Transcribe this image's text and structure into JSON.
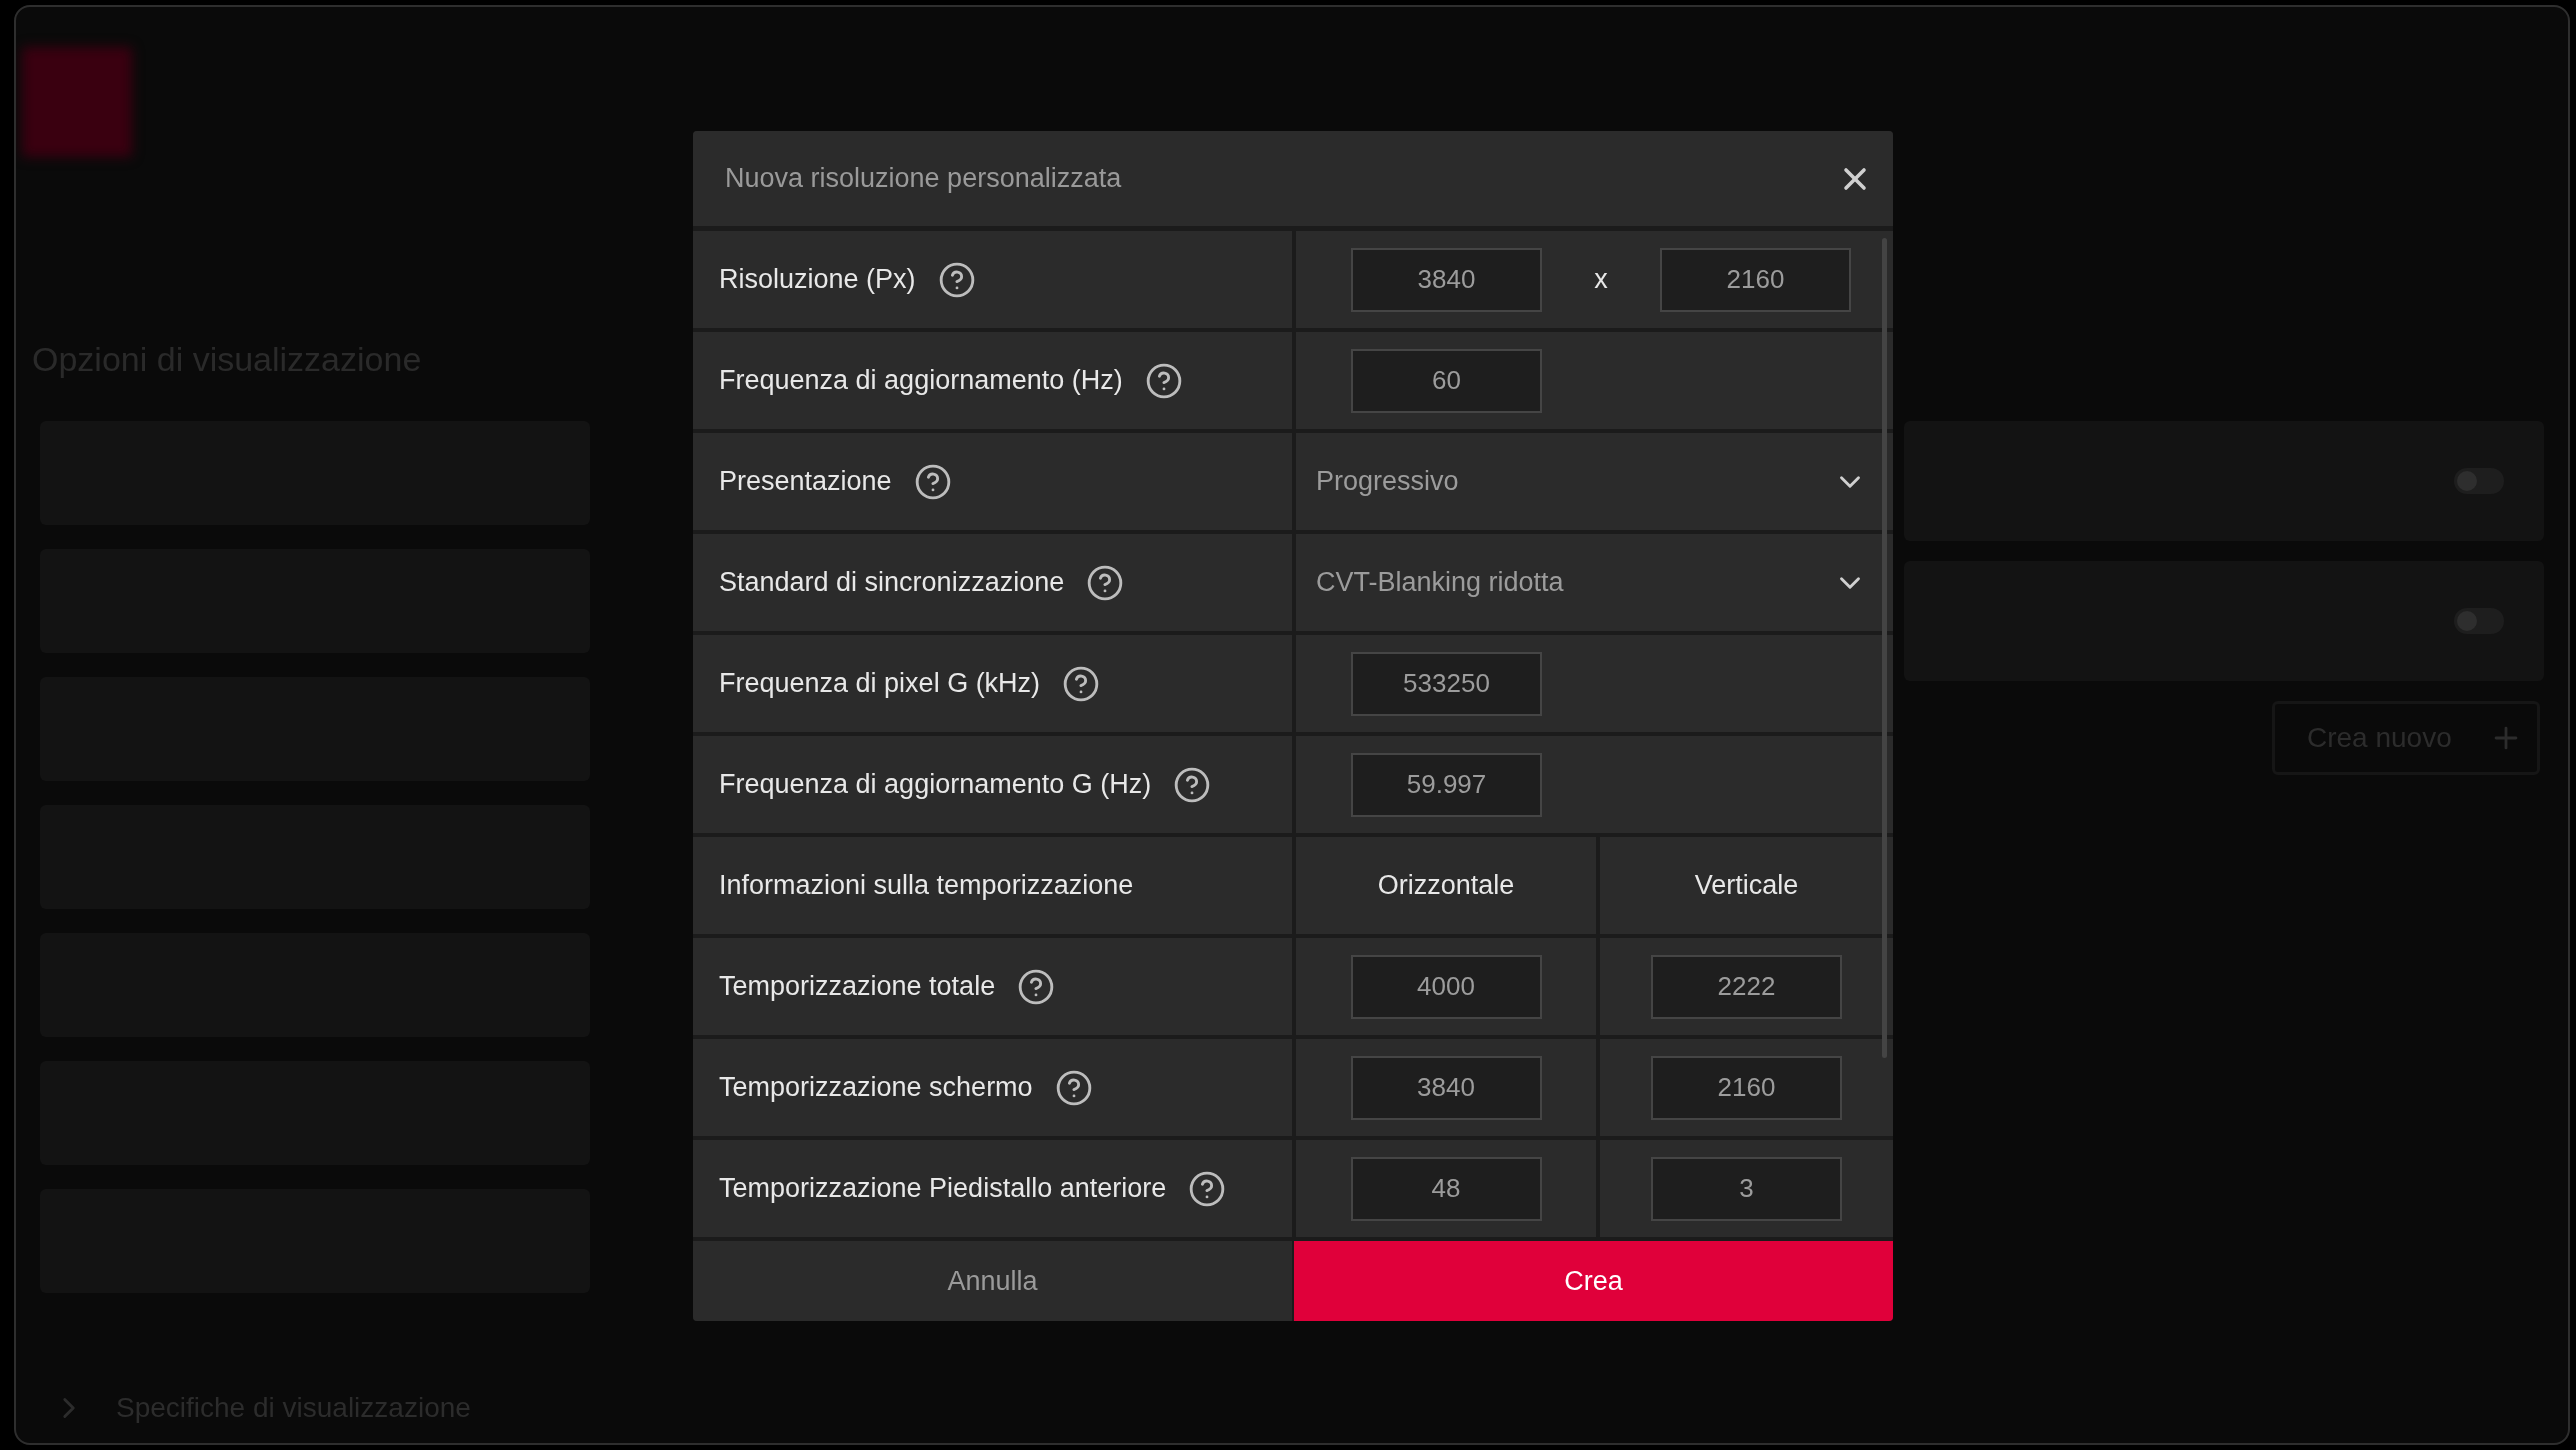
{
  "background": {
    "section_title": "Opzioni di visualizzazione",
    "toggles": [
      {
        "on": false
      },
      {
        "on": false
      }
    ],
    "create_button": {
      "label": "Crea nuovo"
    },
    "footer_link": {
      "label": "Specifiche di visualizzazione",
      "expanded": false
    }
  },
  "dialog": {
    "title": "Nuova risoluzione personalizzata",
    "rows": [
      {
        "kind": "pair",
        "label": "Risoluzione (Px)",
        "help": true,
        "values": [
          "3840",
          "2160"
        ],
        "separator": "x"
      },
      {
        "kind": "single",
        "label": "Frequenza di aggiornamento (Hz)",
        "help": true,
        "values": [
          "60"
        ]
      },
      {
        "kind": "select",
        "label": "Presentazione",
        "help": true,
        "value": "Progressivo"
      },
      {
        "kind": "select",
        "label": "Standard di sincronizzazione",
        "help": true,
        "value": "CVT-Blanking ridotta"
      },
      {
        "kind": "single",
        "label": "Frequenza di pixel G (kHz)",
        "help": true,
        "values": [
          "533250"
        ]
      },
      {
        "kind": "single",
        "label": "Frequenza di aggiornamento G (Hz)",
        "help": true,
        "values": [
          "59.997"
        ]
      },
      {
        "kind": "heading",
        "label": "Informazioni sulla temporizzazione",
        "help": false,
        "columns": [
          "Orizzontale",
          "Verticale"
        ]
      },
      {
        "kind": "split",
        "label": "Temporizzazione totale",
        "help": true,
        "values": [
          "4000",
          "2222"
        ]
      },
      {
        "kind": "split",
        "label": "Temporizzazione schermo",
        "help": true,
        "values": [
          "3840",
          "2160"
        ]
      },
      {
        "kind": "split",
        "label": "Temporizzazione Piedistallo anteriore",
        "help": true,
        "values": [
          "48",
          "3"
        ]
      }
    ],
    "buttons": [
      {
        "label": "Annulla",
        "primary": false
      },
      {
        "label": "Crea",
        "primary": true
      }
    ]
  }
}
